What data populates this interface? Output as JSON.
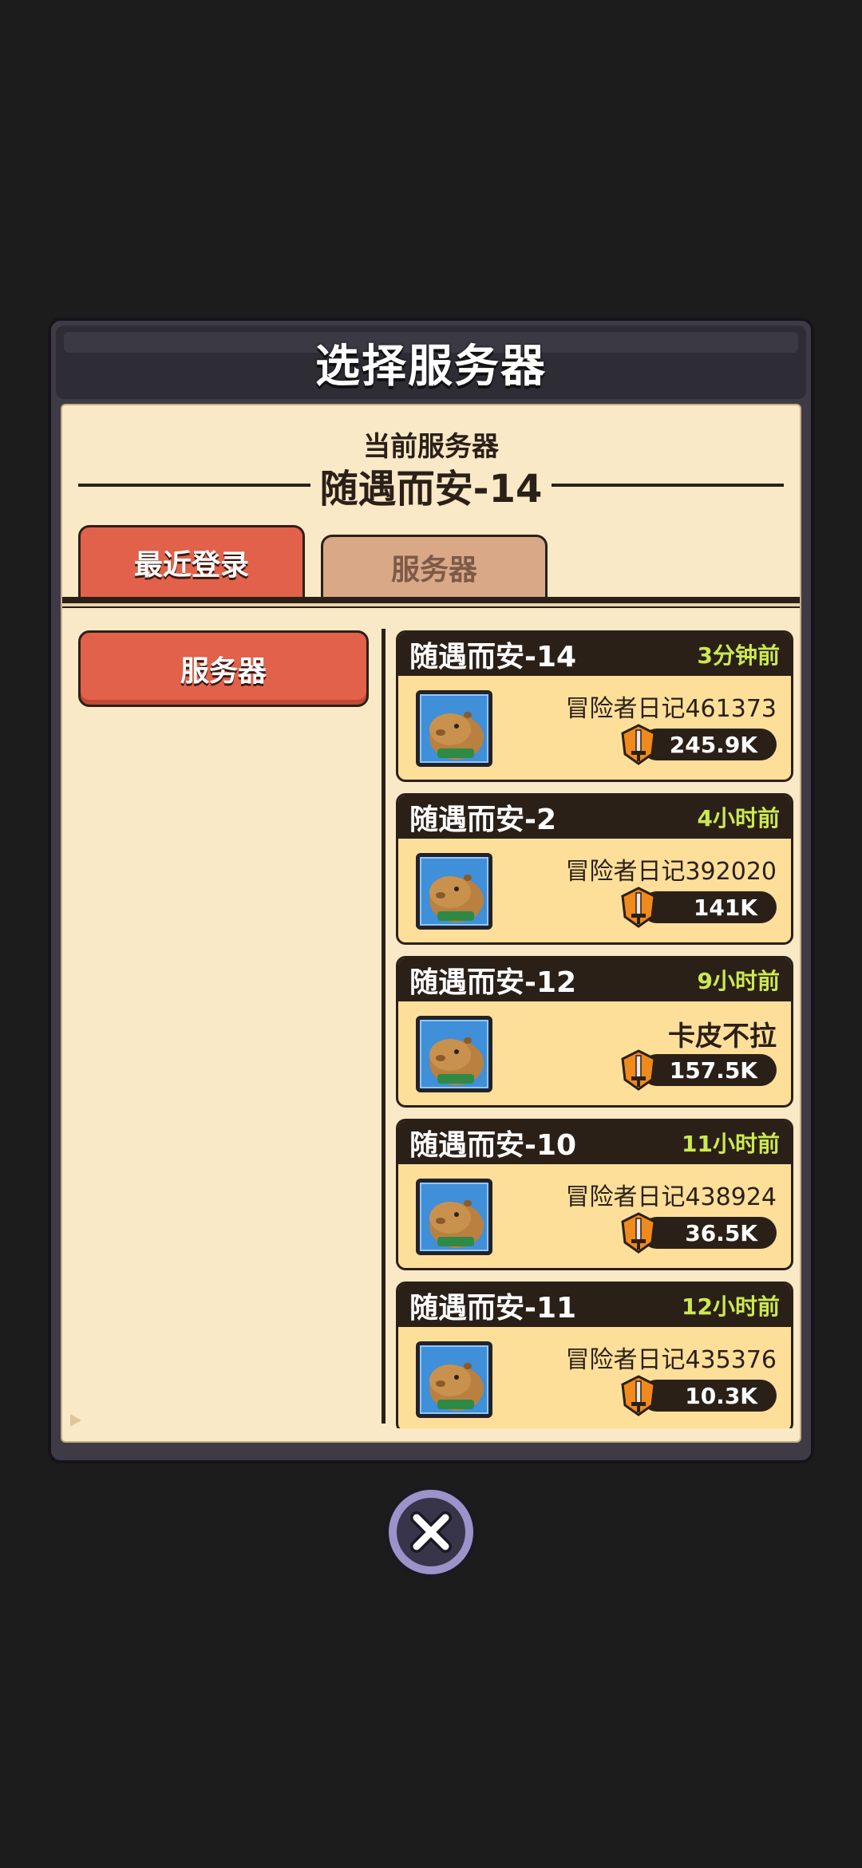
{
  "dialog": {
    "title": "选择服务器",
    "current_label": "当前服务器",
    "current_server": "随遇而安-14"
  },
  "tabs": [
    {
      "label": "最近登录",
      "selected": true
    },
    {
      "label": "服务器",
      "selected": false
    }
  ],
  "sidebar": {
    "button_label": "服务器"
  },
  "servers": [
    {
      "name": "随遇而安-14",
      "time": "3分钟前",
      "player": "冒险者日记461373",
      "power": "245.9K"
    },
    {
      "name": "随遇而安-2",
      "time": "4小时前",
      "player": "冒险者日记392020",
      "power": "141K"
    },
    {
      "name": "随遇而安-12",
      "time": "9小时前",
      "player": "卡皮不拉",
      "power": "157.5K"
    },
    {
      "name": "随遇而安-10",
      "time": "11小时前",
      "player": "冒险者日记438924",
      "power": "36.5K"
    },
    {
      "name": "随遇而安-11",
      "time": "12小时前",
      "player": "冒险者日记435376",
      "power": "10.3K"
    }
  ],
  "icons": {
    "avatar": "capybara-avatar-icon",
    "power": "sword-shield-icon",
    "close": "close-icon"
  },
  "colors": {
    "background": "#1c1c1c",
    "panel": "#fae9c7",
    "tab_active": "#e1614a",
    "tab_inactive": "#d9a987",
    "card": "#fddf9a",
    "time_green": "#cde94f"
  }
}
